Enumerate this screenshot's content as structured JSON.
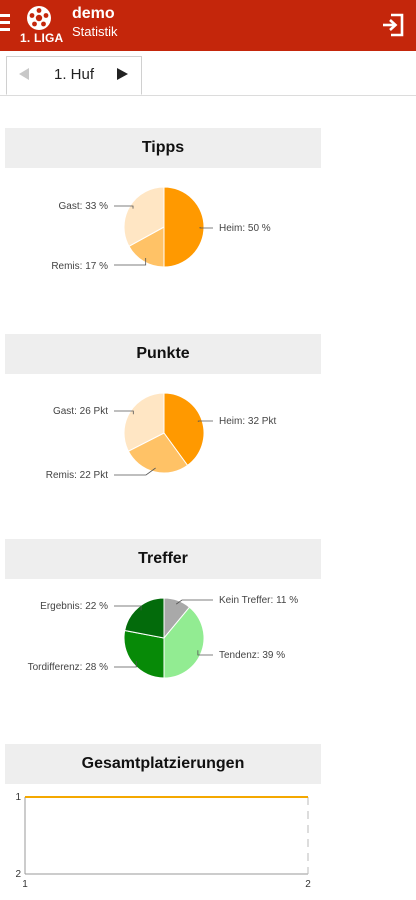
{
  "header": {
    "title": "demo",
    "subtitle": "Statistik",
    "league_label": "1. LIGA"
  },
  "tabs": {
    "current_label": "1. Huf"
  },
  "colors": {
    "header_bg": "#c4260b",
    "orange_dark": "#ff9900",
    "orange_mid": "#ffc266",
    "orange_light": "#ffe6c4",
    "green_dark": "#036b0b",
    "green_mid": "#078a07",
    "green_light": "#92ec92",
    "grey": "#a9a9a9",
    "line": "#f4a800"
  },
  "chart_data": [
    {
      "type": "pie",
      "title": "Tipps",
      "slices": [
        {
          "label": "Heim: 50 %",
          "value": 50
        },
        {
          "label": "Remis: 17 %",
          "value": 17
        },
        {
          "label": "Gast: 33 %",
          "value": 33
        }
      ]
    },
    {
      "type": "pie",
      "title": "Punkte",
      "slices": [
        {
          "label": "Heim: 32 Pkt",
          "value": 32
        },
        {
          "label": "Remis: 22 Pkt",
          "value": 22
        },
        {
          "label": "Gast: 26 Pkt",
          "value": 26
        }
      ]
    },
    {
      "type": "pie",
      "title": "Treffer",
      "slices": [
        {
          "label": "Kein Treffer: 11 %",
          "value": 11
        },
        {
          "label": "Tendenz: 39 %",
          "value": 39
        },
        {
          "label": "Tordifferenz: 28 %",
          "value": 28
        },
        {
          "label": "Ergebnis: 22 %",
          "value": 22
        }
      ]
    },
    {
      "type": "line",
      "title": "Gesamtplatzierungen",
      "x": [
        1,
        2
      ],
      "series": [
        {
          "values": [
            1,
            1
          ]
        }
      ],
      "xticks": [
        "1",
        "2"
      ],
      "yticks": [
        "1",
        "2"
      ],
      "ylim": [
        1,
        2
      ],
      "y_inverted": true
    }
  ]
}
